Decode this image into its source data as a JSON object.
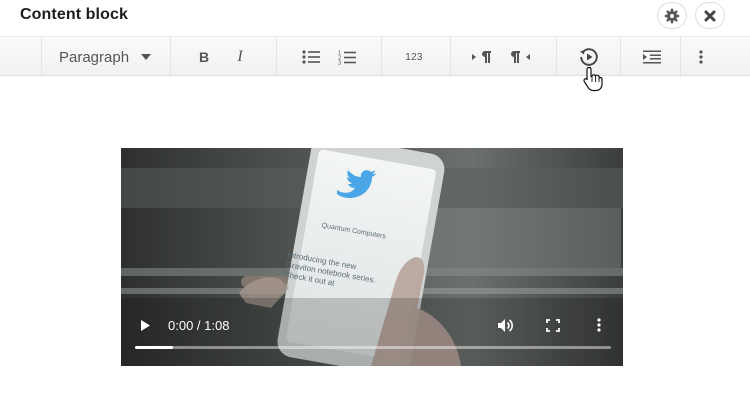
{
  "dialog": {
    "title": "Content block"
  },
  "title_buttons": {
    "settings": "gear-icon",
    "close": "close-icon"
  },
  "toolbar": {
    "paragraph_label": "Paragraph",
    "bold_label": "B",
    "italic_label": "I",
    "numbering_label": "123",
    "icons": [
      "bullet-list-icon",
      "numbered-list-icon",
      "ltr-paragraph-icon",
      "rtl-paragraph-icon",
      "media-icon",
      "indent-icon",
      "more-vertical-icon"
    ]
  },
  "video": {
    "time_display": "0:00 / 1:08",
    "progress": 0.08,
    "phone_screen": {
      "app_name": "Quantum Computers",
      "tweet_text": "Introducing the new Graviton notebook series. Check it out at"
    }
  },
  "colors": {
    "toolbar_bg": "#f3f3f3",
    "icon": "#555555",
    "twitter_blue": "#4aa6e6"
  }
}
